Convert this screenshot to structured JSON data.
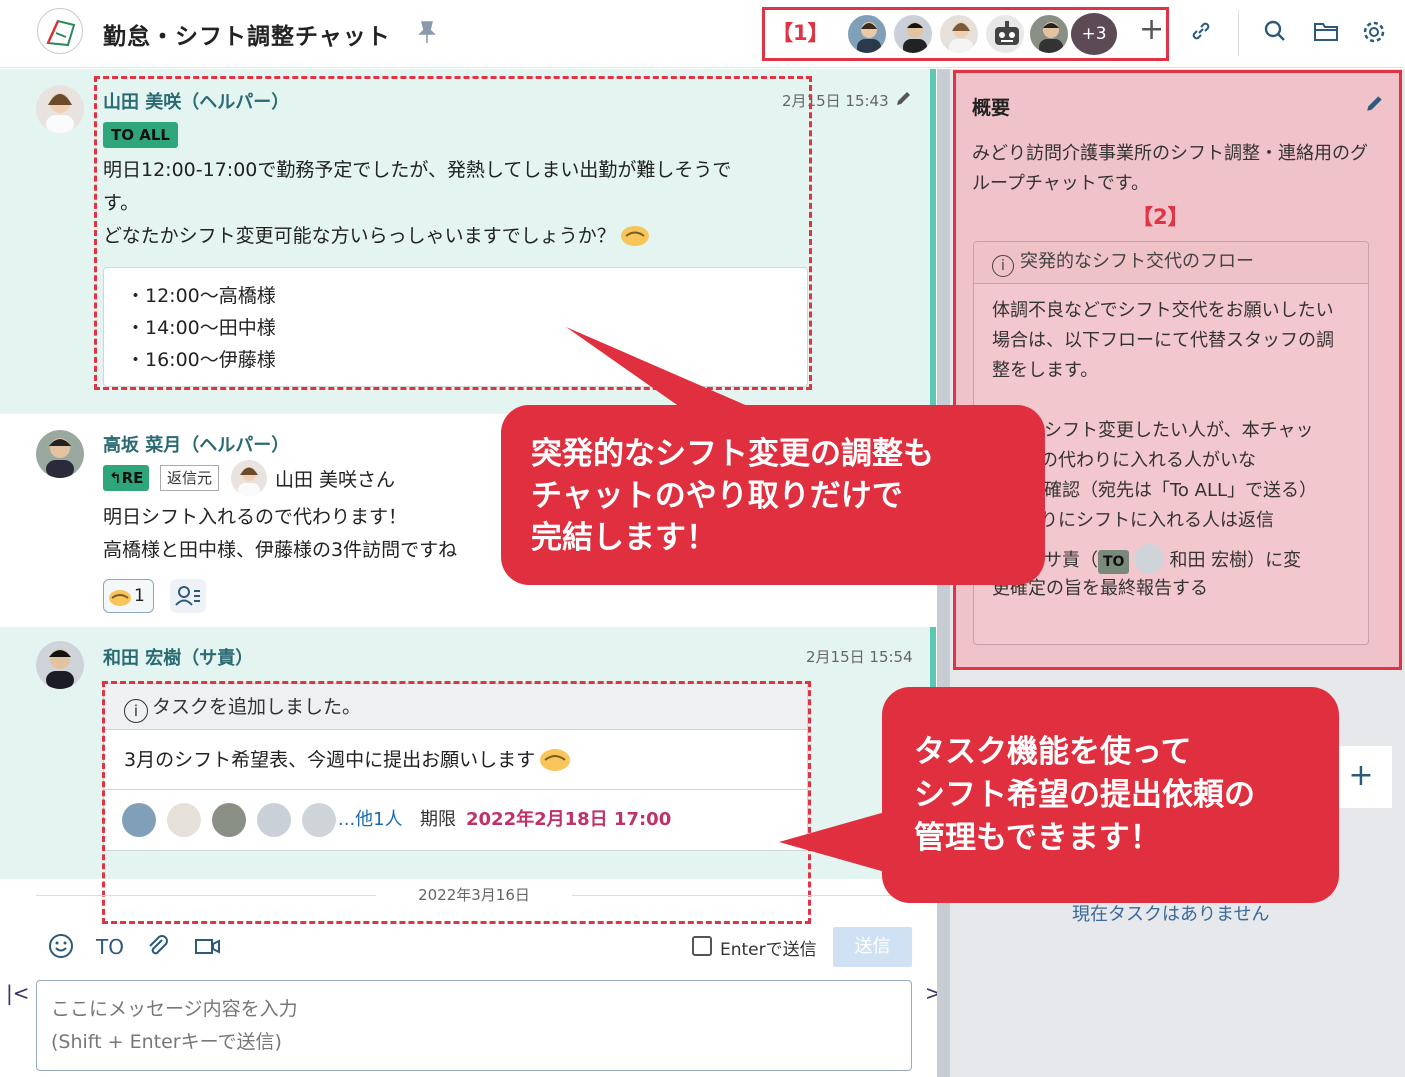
{
  "header": {
    "title": "勤怠・シフト調整チャット",
    "annotation_label": "【1】",
    "member_more": "+3",
    "add_member": "+"
  },
  "messages": [
    {
      "name": "山田 美咲（ヘルパー）",
      "time": "2月15日 15:43",
      "to_badge": "TO ALL",
      "lines": [
        "明日12:00-17:00で勤務予定でしたが、発熱してしまい出勤が難しそうで",
        "す。",
        "どなたかシフト変更可能な方いらっしゃいますでしょうか？"
      ],
      "quote_lines": [
        "・12:00〜高橋様",
        "・14:00〜田中様",
        "・16:00〜伊藤様"
      ]
    },
    {
      "name": "高坂 菜月（ヘルパー）",
      "re_badge": "RE",
      "reply_source": "返信元",
      "reply_to": "山田 美咲さん",
      "lines": [
        "明日シフト入れるので代わります！",
        "高橋様と田中様、伊藤様の3件訪問ですね"
      ],
      "reaction_count": "1"
    },
    {
      "name": "和田 宏樹（サ責）",
      "time": "2月15日 15:54",
      "task_head": "タスクを追加しました。",
      "task_body": "3月のシフト希望表、今週中に提出お願いします",
      "task_others": "...他1人",
      "task_deadline_label": "期限",
      "task_deadline": "2022年2月18日 17:00"
    }
  ],
  "date_separator": "2022年3月16日",
  "composer": {
    "to_label": "TO",
    "enter_label": "Enterで送信",
    "send_label": "送信",
    "placeholder_line1": "ここにメッセージ内容を入力",
    "placeholder_line2": "(Shift + Enterキーで送信)"
  },
  "overview": {
    "title": "概要",
    "description": "みどり訪問介護事業所のシフト調整・連絡用のグループチャットです。",
    "annotation_label": "【2】",
    "flow_title": "突発的なシフト交代のフロー",
    "flow_intro": "体調不良などでシフト交代をお願いしたい場合は、以下フローにて代替スタッフの調整をします。",
    "flow_step1": "シフト変更したい人が、本チャッ",
    "flow_step2": "自分の代わりに入れる人がいな",
    "flow_step3": "確認（宛先は「To ALL」で送る）",
    "flow_step4": "代わりにシフトに入れる人は返信",
    "flow_step5_prefix": "サ責（",
    "flow_step5_to": "TO",
    "flow_step5_name": "和田 宏樹）に変",
    "flow_step5_end": "更確定の旨を最終報告する"
  },
  "tasks": {
    "add": "+",
    "empty": "現在タスクはありません"
  },
  "callouts": {
    "c1_line1": "突発的なシフト変更の調整も",
    "c1_line2": "チャットのやり取りだけで",
    "c1_line3": "完結します！",
    "c2_line1": "タスク機能を使って",
    "c2_line2": "シフト希望の提出依頼の",
    "c2_line3": "管理もできます！"
  },
  "colors": {
    "accent_red": "#e03445",
    "to_badge_green": "#2ea67a",
    "deadline_magenta": "#c0306a",
    "mention_bg": "#e4f5f1"
  }
}
